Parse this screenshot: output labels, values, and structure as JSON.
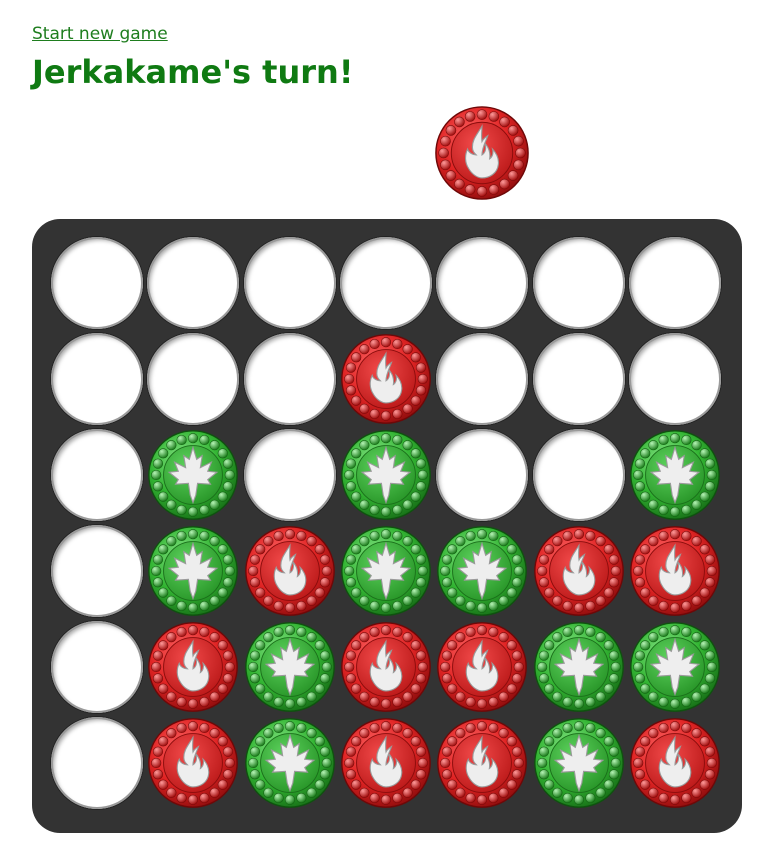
{
  "header": {
    "new_game_label": "Start new game",
    "turn_text": "Jerkakame's turn!"
  },
  "current_player": "red",
  "colors": {
    "red": "#e02424",
    "green": "#33b533",
    "board": "#333333",
    "title": "#0f7a12"
  },
  "icons": {
    "red": "flame-icon",
    "green": "maple-leaf-icon"
  },
  "board": {
    "columns": 7,
    "rows": 6,
    "cells": [
      [
        "",
        "",
        "",
        "",
        "",
        "",
        ""
      ],
      [
        "",
        "",
        "",
        "R",
        "",
        "",
        ""
      ],
      [
        "",
        "G",
        "",
        "G",
        "",
        "",
        "G"
      ],
      [
        "",
        "G",
        "R",
        "G",
        "G",
        "R",
        "R"
      ],
      [
        "",
        "R",
        "G",
        "R",
        "R",
        "G",
        "G"
      ],
      [
        "",
        "R",
        "G",
        "R",
        "R",
        "G",
        "R"
      ]
    ]
  }
}
